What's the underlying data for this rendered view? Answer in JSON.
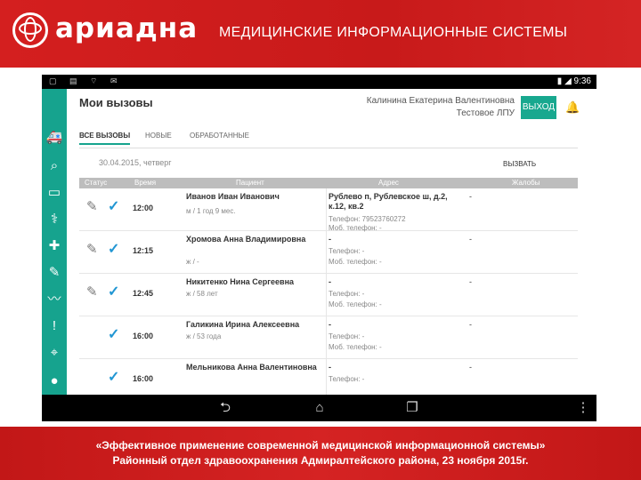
{
  "slide": {
    "logo_text": "ариадна",
    "title": "МЕДИЦИНСКИЕ ИНФОРМАЦИОННЫЕ СИСТЕМЫ",
    "footer_line1": "«Эффективное применение современной медицинской информационной системы»",
    "footer_line2": "Районный отдел здравоохранения Адмиралтейского района, 23 ноября 2015г."
  },
  "statusbar": {
    "time": "9:36"
  },
  "app": {
    "page_title": "Мои вызовы",
    "user_name": "Калинина Екатерина Валентиновна",
    "user_org": "Тестовое ЛПУ",
    "logout_label": "ВЫХОД",
    "tabs": [
      {
        "label": "ВСЕ ВЫЗОВЫ",
        "active": true
      },
      {
        "label": "НОВЫЕ",
        "active": false
      },
      {
        "label": "ОБРАБОТАННЫЕ",
        "active": false
      }
    ],
    "date_text": "30.04.2015, четверг",
    "call_button": "ВЫЗВАТЬ",
    "columns": [
      "Статус",
      "Время",
      "Пациент",
      "Адрес",
      "Жалобы"
    ],
    "rows": [
      {
        "time": "12:00",
        "name": "Иванов Иван Иванович",
        "info": "м / 1 год 9 мес.",
        "address": "Рублево п, Рублевское ш, д.2, к.12, кв.2",
        "phone": "Телефон: 79523760272",
        "mobile": "Моб. телефон: -",
        "complaints": "-",
        "editable": true
      },
      {
        "time": "12:15",
        "name": "Хромова Анна Владимировна",
        "info": "ж / -",
        "address": "-",
        "phone": "Телефон: -",
        "mobile": "Моб. телефон: -",
        "complaints": "-",
        "editable": true
      },
      {
        "time": "12:45",
        "name": "Никитенко Нина Сергеевна",
        "info": "ж / 58 лет",
        "address": "-",
        "phone": "Телефон: -",
        "mobile": "Моб. телефон: -",
        "complaints": "-",
        "editable": true
      },
      {
        "time": "16:00",
        "name": "Галикина Ирина Алексеевна",
        "info": "ж / 53 года",
        "address": "-",
        "phone": "Телефон: -",
        "mobile": "Моб. телефон: -",
        "complaints": "-",
        "editable": false
      },
      {
        "time": "16:00",
        "name": "Мельникова Анна Валентиновна",
        "info": "",
        "address": "-",
        "phone": "Телефон: -",
        "mobile": "",
        "complaints": "-",
        "editable": false
      }
    ]
  },
  "colors": {
    "slide_red": "#d41f1f",
    "accent_teal": "#16a38e",
    "check_blue": "#2196d3",
    "bell_green": "#8cc63f"
  },
  "icons": {
    "sidebar": [
      "ambulance-icon",
      "search-doc-icon",
      "folder-icon",
      "pills-icon",
      "medical-cross-icon",
      "notes-icon",
      "heartbeat-icon",
      "alert-icon",
      "location-icon",
      "info-icon"
    ],
    "nav": [
      "back-icon",
      "home-icon",
      "recent-apps-icon",
      "menu-icon"
    ]
  }
}
